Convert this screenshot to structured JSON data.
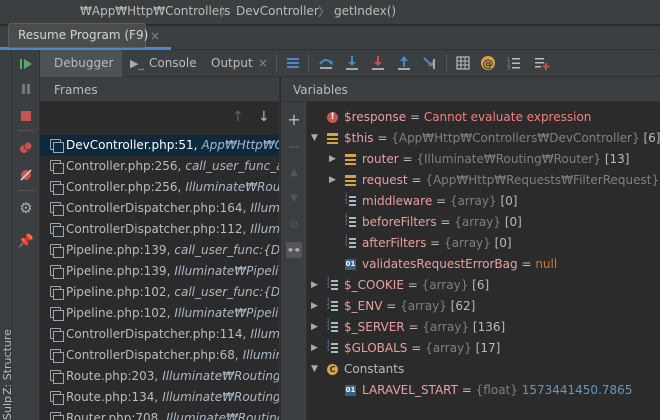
{
  "breadcrumb": {
    "items": [
      "₩App₩Http₩Controllers",
      "DevController",
      "getIndex()"
    ],
    "separator": "〉"
  },
  "tooltip": {
    "text": "Resume Program (F9)"
  },
  "tab_strip": {
    "close_glyph": "×"
  },
  "toolbar": {
    "tabs": [
      {
        "label": "Debugger",
        "icon": "debugger-icon"
      },
      {
        "label": "Console",
        "icon": "console-icon"
      },
      {
        "label": "Output",
        "icon": "output-icon"
      }
    ],
    "close_glyph": "×"
  },
  "side_labels": {
    "structure": "Z: Structure",
    "bottom": "Sulp"
  },
  "frames": {
    "title": "Frames",
    "rows": [
      {
        "file": "DevController.php:51,",
        "method": "App₩Http₩Cont",
        "selected": true
      },
      {
        "file": "Controller.php:256,",
        "method": "call_user_func_array",
        "selected": false
      },
      {
        "file": "Controller.php:256,",
        "method": "Illuminate₩Routing₩Contro",
        "selected": false
      },
      {
        "file": "ControllerDispatcher.php:164,",
        "method": "Illuminat",
        "selected": false
      },
      {
        "file": "ControllerDispatcher.php:112,",
        "method": "Illuminat",
        "selected": false
      },
      {
        "file": "Pipeline.php:139,",
        "method": "call_user_func:{D:₩My",
        "selected": false
      },
      {
        "file": "Pipeline.php:139,",
        "method": "Illuminate₩Pipeline₩",
        "selected": false
      },
      {
        "file": "Pipeline.php:102,",
        "method": "call_user_func:{D:₩My",
        "selected": false
      },
      {
        "file": "Pipeline.php:102,",
        "method": "Illuminate₩Pipeline₩",
        "selected": false
      },
      {
        "file": "ControllerDispatcher.php:114,",
        "method": "Illuminat",
        "selected": false
      },
      {
        "file": "ControllerDispatcher.php:68,",
        "method": "Illuminate",
        "selected": false
      },
      {
        "file": "Route.php:203,",
        "method": "Illuminate₩Routing₩Rou",
        "selected": false
      },
      {
        "file": "Route.php:134,",
        "method": "Illuminate₩Routing₩Rou",
        "selected": false
      },
      {
        "file": "Router.php:708,",
        "method": "Illuminate₩Routing₩R",
        "selected": false
      }
    ]
  },
  "variables": {
    "title": "Variables",
    "rows": [
      {
        "level": 0,
        "caret": "",
        "icon": "error-icon",
        "name": "$response",
        "sep": " = ",
        "type": "",
        "value": "Cannot evaluate expression",
        "value_style": "error",
        "count": ""
      },
      {
        "level": 0,
        "caret": "▼",
        "icon": "object-icon",
        "name": "$this",
        "sep": " = ",
        "type": "{App₩Http₩Controllers₩DevController}",
        "value": "",
        "value_style": "",
        "count": "[6]"
      },
      {
        "level": 1,
        "caret": "▶",
        "icon": "object-icon",
        "name": "router",
        "sep": " = ",
        "type": "{Illuminate₩Routing₩Router}",
        "value": "",
        "value_style": "",
        "count": "[13]"
      },
      {
        "level": 1,
        "caret": "▶",
        "icon": "object-icon",
        "name": "request",
        "sep": " = ",
        "type": "{App₩Http₩Requests₩FilterRequest}",
        "value": "",
        "value_style": "",
        "count": "[38]"
      },
      {
        "level": 1,
        "caret": "",
        "icon": "array-icon",
        "name": "middleware",
        "sep": " = ",
        "type": "{array}",
        "value": "",
        "value_style": "",
        "count": "[0]"
      },
      {
        "level": 1,
        "caret": "",
        "icon": "array-icon",
        "name": "beforeFilters",
        "sep": " = ",
        "type": "{array}",
        "value": "",
        "value_style": "",
        "count": "[0]"
      },
      {
        "level": 1,
        "caret": "",
        "icon": "array-icon",
        "name": "afterFilters",
        "sep": " = ",
        "type": "{array}",
        "value": "",
        "value_style": "",
        "count": "[0]"
      },
      {
        "level": 1,
        "caret": "",
        "icon": "primitive-icon",
        "name": "validatesRequestErrorBag",
        "sep": " = ",
        "type": "",
        "value": "null",
        "value_style": "orange",
        "count": ""
      },
      {
        "level": 0,
        "caret": "▶",
        "icon": "array-icon",
        "name": "$_COOKIE",
        "sep": " = ",
        "type": "{array}",
        "value": "",
        "value_style": "",
        "count": "[6]"
      },
      {
        "level": 0,
        "caret": "▶",
        "icon": "array-icon",
        "name": "$_ENV",
        "sep": " = ",
        "type": "{array}",
        "value": "",
        "value_style": "",
        "count": "[62]"
      },
      {
        "level": 0,
        "caret": "▶",
        "icon": "array-icon",
        "name": "$_SERVER",
        "sep": " = ",
        "type": "{array}",
        "value": "",
        "value_style": "",
        "count": "[136]"
      },
      {
        "level": 0,
        "caret": "▶",
        "icon": "array-icon",
        "name": "$GLOBALS",
        "sep": " = ",
        "type": "{array}",
        "value": "",
        "value_style": "",
        "count": "[17]"
      },
      {
        "level": 0,
        "caret": "▼",
        "icon": "constants-icon",
        "name": "Constants",
        "sep": "",
        "type": "",
        "value": "",
        "value_style": "",
        "count": ""
      },
      {
        "level": 1,
        "caret": "",
        "icon": "primitive-icon",
        "name": "LARAVEL_START",
        "sep": " = ",
        "type": "{float}",
        "value": "1573441450.7865",
        "value_style": "blue",
        "count": ""
      }
    ]
  },
  "colors": {
    "accent": "#4a88c7",
    "selection": "#0d293e",
    "resume_green": "#59a869",
    "stop_red": "#c75450",
    "var_name": "#e8a0a0",
    "value_blue": "#6897bb",
    "value_orange": "#cc7832"
  }
}
